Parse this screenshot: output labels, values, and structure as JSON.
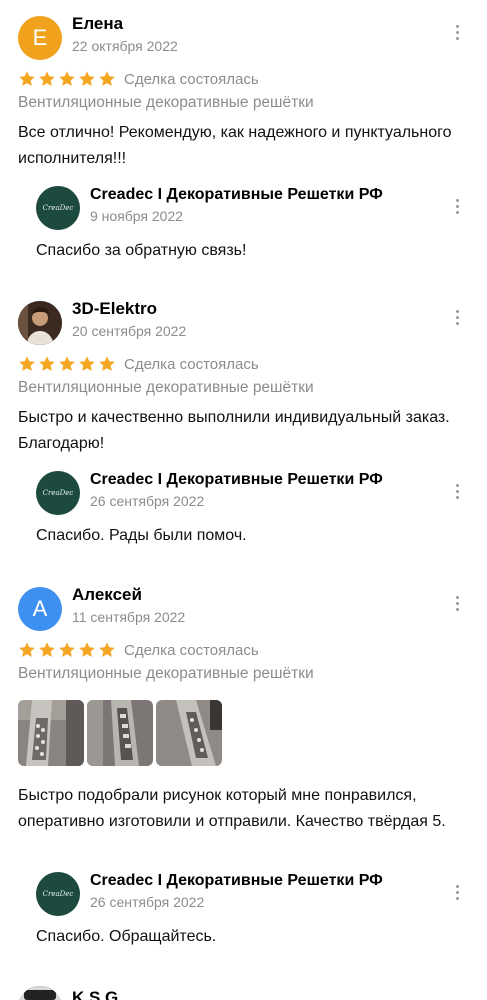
{
  "reviews": [
    {
      "author": "Елена",
      "avatar_letter": "Е",
      "avatar_color": "#f0a21c",
      "date": "22 октября 2022",
      "stars": 5,
      "deal_status": "Сделка состоялась",
      "category": "Вентиляционные декоративные решётки",
      "text": "Все отлично! Рекомендую, как надежного и пунктуального исполнителя!!!",
      "reply": {
        "author": "Creadec I Декоративные Решетки РФ",
        "logo_text": "CreaDec",
        "date": "9 ноября 2022",
        "text": "Спасибо за обратную связь!"
      }
    },
    {
      "author": "3D-Elektro",
      "avatar_letter": "",
      "avatar_color": "#5a4030",
      "date": "20 сентября 2022",
      "stars": 5,
      "deal_status": "Сделка состоялась",
      "category": "Вентиляционные декоративные решётки",
      "text": "Быстро и качественно выполнили индивидуальный заказ. Благодарю!",
      "reply": {
        "author": "Creadec I Декоративные Решетки РФ",
        "logo_text": "CreaDec",
        "date": "26 сентября 2022",
        "text": "Спасибо. Рады были помоч."
      }
    },
    {
      "author": "Алексей",
      "avatar_letter": "А",
      "avatar_color": "#3d8ff0",
      "date": "11 сентября 2022",
      "stars": 5,
      "deal_status": "Сделка состоялась",
      "category": "Вентиляционные декоративные решётки",
      "text": "Быстро подобрали рисунок который мне понравился, оперативно изготовили и отправили. Качество твёрдая 5.",
      "reply": {
        "author": "Creadec I Декоративные Решетки РФ",
        "logo_text": "CreaDec",
        "date": "26 сентября 2022",
        "text": "Спасибо. Обращайтесь."
      }
    },
    {
      "author": "K.S.G",
      "avatar_letter": "",
      "avatar_color": "#333333"
    }
  ],
  "colors": {
    "star": "#f5a623",
    "muted": "#8c8c8c"
  }
}
